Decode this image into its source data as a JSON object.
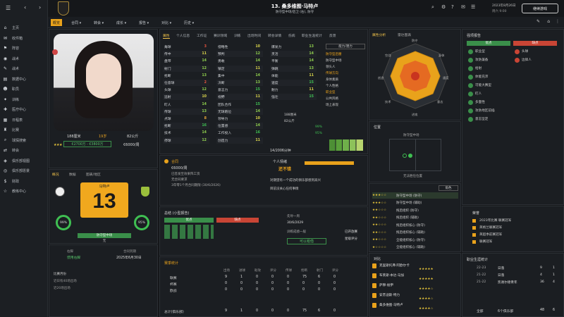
{
  "sidebar": {
    "items": [
      {
        "icon": "home-icon",
        "glyph": "⌂",
        "label": "主页"
      },
      {
        "icon": "inbox-icon",
        "glyph": "✉",
        "label": "收件箱"
      },
      {
        "icon": "squad-icon",
        "glyph": "⚑",
        "label": "阵容"
      },
      {
        "icon": "team-icon",
        "glyph": "◉",
        "label": "战术"
      },
      {
        "icon": "tactics-icon",
        "glyph": "✎",
        "label": "战术"
      },
      {
        "icon": "data-icon",
        "glyph": "▤",
        "label": "数据中心"
      },
      {
        "icon": "staff-icon",
        "glyph": "☻",
        "label": "职员"
      },
      {
        "icon": "training-icon",
        "glyph": "✦",
        "label": "训练"
      },
      {
        "icon": "medical-icon",
        "glyph": "✚",
        "label": "医疗中心"
      },
      {
        "icon": "schedule-icon",
        "glyph": "▦",
        "label": "日程表"
      },
      {
        "icon": "competition-icon",
        "glyph": "♜",
        "label": "比赛"
      },
      {
        "icon": "scouting-icon",
        "glyph": "⌕",
        "label": "球探搜索"
      },
      {
        "icon": "transfer-icon",
        "glyph": "⇄",
        "label": "转会"
      },
      {
        "icon": "club-info-icon",
        "glyph": "◈",
        "label": "俱乐部视图"
      },
      {
        "icon": "club-vision-icon",
        "glyph": "◎",
        "label": "俱乐部愿景"
      },
      {
        "icon": "finance-icon",
        "glyph": "$",
        "label": "财政"
      },
      {
        "icon": "career-icon",
        "glyph": "☆",
        "label": "教练中心"
      }
    ]
  },
  "header": {
    "player_title": "13. 桑多维图·马特卢",
    "player_subtitle": "防守型中场/后卫 (右), 防守",
    "date": "2023年8月26日",
    "time": "周六 9:00",
    "continue_label": "继续游戏"
  },
  "nav": {
    "items": [
      "概览",
      "合同",
      "转会",
      "成长",
      "报告",
      "对比",
      "历史"
    ]
  },
  "profile": {
    "height": "188厘米",
    "age": "19岁",
    "weight": "82公斤",
    "value": "€2700万 - €3800万",
    "wage": "€6000/周",
    "number": "13",
    "name_badge": "马特卢",
    "position_label": "防守型中场",
    "position_sub": "无",
    "tabs": [
      "概况",
      "数据",
      "图表/地区"
    ],
    "morale_label": "99%",
    "condition_label": "95%",
    "foot_label": "右脚",
    "foot_value": "惯用右脚",
    "contract_label": "合同到期",
    "contract_value": "2025年6月30日",
    "notes": [
      "比赛月份",
      "近日有40场出场",
      "近20场出场"
    ]
  },
  "attributes": {
    "tabs": [
      "属性",
      "个人信息",
      "工作证",
      "赛训领域",
      "训练",
      "出场时间",
      "转会详情",
      "伤病",
      "职业生涯统计",
      "反馈"
    ],
    "technical": [
      {
        "name": "角球",
        "value": "3"
      },
      {
        "name": "传中",
        "value": "11"
      },
      {
        "name": "盘带",
        "value": "14"
      },
      {
        "name": "射门",
        "value": "12"
      },
      {
        "name": "抢断",
        "value": "13"
      },
      {
        "name": "任意球",
        "value": "2"
      },
      {
        "name": "头球",
        "value": "12"
      },
      {
        "name": "远射",
        "value": "10"
      },
      {
        "name": "盯人",
        "value": "14"
      },
      {
        "name": "传球",
        "value": "13"
      },
      {
        "name": "点球",
        "value": "8"
      },
      {
        "name": "抢断",
        "value": "16"
      },
      {
        "name": "技术",
        "value": "14"
      },
      {
        "name": "停球",
        "value": "12"
      }
    ],
    "mental": [
      {
        "name": "侵略性",
        "value": "10"
      },
      {
        "name": "预判",
        "value": "12"
      },
      {
        "name": "勇敢",
        "value": "14"
      },
      {
        "name": "镇定",
        "value": "11"
      },
      {
        "name": "集中",
        "value": "14"
      },
      {
        "name": "决断",
        "value": "13"
      },
      {
        "name": "意志力",
        "value": "15"
      },
      {
        "name": "视野",
        "value": "11"
      },
      {
        "name": "团队合作",
        "value": "15"
      },
      {
        "name": "无球跑位",
        "value": "14"
      },
      {
        "name": "领导力",
        "value": "10"
      },
      {
        "name": "位置感",
        "value": "14"
      },
      {
        "name": "工作投入",
        "value": "16"
      },
      {
        "name": "创造力",
        "value": "11"
      }
    ],
    "physical": [
      {
        "name": "爆发力",
        "value": "13"
      },
      {
        "name": "灵活",
        "value": "14"
      },
      {
        "name": "平衡",
        "value": "14"
      },
      {
        "name": "弹跳",
        "value": "13"
      },
      {
        "name": "体能",
        "value": "11"
      },
      {
        "name": "速度",
        "value": "15"
      },
      {
        "name": "耐力",
        "value": "11"
      },
      {
        "name": "强壮",
        "value": "15"
      }
    ],
    "body": {
      "height": "188厘米",
      "weight": "82公斤",
      "condition": "99%",
      "fitness": "95%"
    },
    "ability_label": "能力/潜力",
    "roles": [
      "防守型后腰",
      "防守型中场",
      "领头人",
      "传球方向",
      "身体素质",
      "个人性格",
      "职业型",
      "公共风格",
      "场上表现"
    ],
    "apps_label": "14/2006分钟"
  },
  "scout": {
    "contract_title": "合同",
    "contract_rows": [
      "€6000/周",
      "已签发至效果阵工资",
      "无合同要求",
      "3年零1个月合同期限 (30/6/2026)"
    ],
    "personal_title": "个人情绪",
    "personal_value": "还不错",
    "concerns": [
      "对期望有一个成功的俱乐部感到高兴",
      "目前没关心任何事情"
    ]
  },
  "scout_report": {
    "title": "总结 (小型报告)",
    "pros_label": "优点",
    "cons_label": "缺点",
    "matches_label": "先导一周",
    "date_label": "30/6/2029",
    "training_label": "训练成绩一般",
    "status": "已开放赛",
    "status2": "星级评分",
    "btn": "可以租借"
  },
  "season": {
    "title": "赛季统计",
    "headers": [
      "出场",
      "进球",
      "助攻",
      "评分",
      "传球",
      "抢断",
      "射门",
      "评分"
    ],
    "rows": [
      {
        "label": "联赛",
        "vals": [
          "9",
          "1",
          "0",
          "0",
          "0",
          "75",
          "6",
          "0"
        ]
      },
      {
        "label": "杯赛",
        "vals": [
          "0",
          "0",
          "0",
          "0",
          "0",
          "0",
          "0",
          "0"
        ]
      },
      {
        "label": "欧战",
        "vals": [
          "0",
          "0",
          "0",
          "0",
          "0",
          "0",
          "0",
          "0"
        ]
      }
    ],
    "total_label": "总计(俱乐部)",
    "total_vals": [
      "9",
      "1",
      "0",
      "0",
      "0",
      "75",
      "6",
      "0"
    ]
  },
  "radar": {
    "tabs": [
      "属性分析",
      "雷达图表"
    ],
    "labels": [
      "防守",
      "身体",
      "速度",
      "意志",
      "进攻",
      "技术",
      "创造",
      "空战"
    ]
  },
  "position": {
    "title": "位置",
    "main_label": "防守型中场",
    "secondary_label": "无法胜任位置",
    "filter": "角色"
  },
  "roles": {
    "items": [
      {
        "stars": "★★★☆☆",
        "label": "防守型中场 (防守)"
      },
      {
        "stars": "★★★☆☆",
        "label": "防守型中场 (辅助)"
      },
      {
        "stars": "★★☆☆☆",
        "label": "拖后组织 (防守)"
      },
      {
        "stars": "★★☆☆☆",
        "label": "拖后组织 (辅助)"
      },
      {
        "stars": "★★☆☆☆",
        "label": "拖后组织核心 (防守)"
      },
      {
        "stars": "★★☆☆☆",
        "label": "拖后组织核心 (辅助)"
      },
      {
        "stars": "★★☆☆☆",
        "label": "全能组织核心 (防守)"
      },
      {
        "stars": "★☆☆☆☆",
        "label": "全能组织核心 (辅助)"
      }
    ]
  },
  "compare": {
    "title": "对比",
    "rows": [
      {
        "name": "克里斯托弗·阿欧尔卡",
        "stars": "★★★★★"
      },
      {
        "name": "布莱斯·本达·马加",
        "stars": "★★★★★"
      },
      {
        "name": "萨穆·福伊",
        "stars": "★★★★☆"
      },
      {
        "name": "安苏迪斯·特力",
        "stars": "★★★★☆"
      },
      {
        "name": "桑多维图·马特卢",
        "stars": "★★★★☆"
      }
    ]
  },
  "strengths": {
    "title": "强项报告",
    "pros_label": "优点",
    "cons_label": "缺点",
    "pros": [
      "职业型",
      "攻防兼备",
      "给射",
      "体能充沛",
      "可能大赛型",
      "盯人",
      "多面性",
      "攻防地区前插",
      "意志坚定"
    ],
    "cons": [
      "头球",
      "边锋人"
    ]
  },
  "career": {
    "title": "荣誉",
    "rows": [
      "2023年比赛 联赛冠军",
      "英格兰联赛冠军",
      "英超季前赛冠军",
      "联赛冠军"
    ]
  },
  "career_stats": {
    "title": "职业生涯统计",
    "rows": [
      {
        "season": "22-23",
        "club": "日落",
        "apps": "9",
        "gls": "1",
        "av": "1"
      },
      {
        "season": "21-22",
        "club": "日落",
        "apps": "4",
        "gls": "1",
        "av": "1"
      },
      {
        "season": "21-22",
        "club": "凯谢尔德青年",
        "apps": "36",
        "gls": "4",
        "av": "1"
      }
    ],
    "total_label": "全部",
    "total_club": "6个俱乐部",
    "total_apps": "48",
    "total_gls": "6"
  },
  "colors": {
    "accent": "#e9a21b",
    "positive": "#3fbf52",
    "negative": "#e8543f",
    "panel": "#1b1e22"
  }
}
